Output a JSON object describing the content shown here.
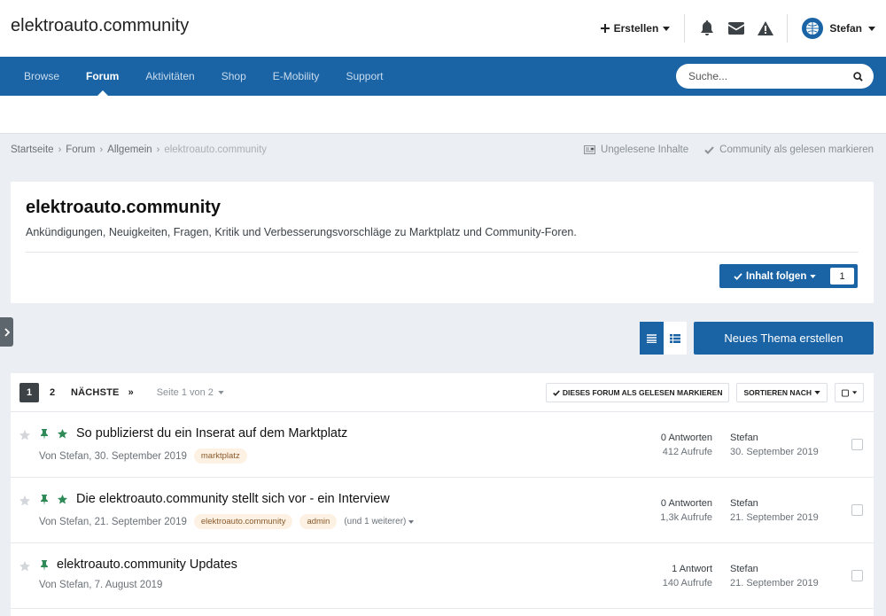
{
  "header": {
    "site_title": "elektroauto.community",
    "create_label": "Erstellen",
    "user_name": "Stefan"
  },
  "nav": {
    "items": [
      "Browse",
      "Forum",
      "Aktivitäten",
      "Shop",
      "E-Mobility",
      "Support"
    ],
    "active": "Forum",
    "search_placeholder": "Suche..."
  },
  "breadcrumb": {
    "items": [
      "Startseite",
      "Forum",
      "Allgemein",
      "elektroauto.community"
    ],
    "unread_label": "Ungelesene Inhalte",
    "mark_read_label": "Community als gelesen markieren"
  },
  "forum": {
    "title": "elektroauto.community",
    "description": "Ankündigungen, Neuigkeiten, Fragen, Kritik und Verbesserungsvorschläge zu Marktplatz und Community-Foren.",
    "follow_label": "Inhalt folgen",
    "follow_count": "1",
    "new_topic_label": "Neues Thema erstellen"
  },
  "toolbar": {
    "pages": [
      "1",
      "2"
    ],
    "next_label": "NÄCHSTE",
    "last_label": "»",
    "page_info": "Seite 1 von 2",
    "mark_forum_read_label": "DIESES FORUM ALS GELESEN MARKIEREN",
    "sort_label": "SORTIEREN NACH"
  },
  "topics": [
    {
      "title": "So publizierst du ein Inserat auf dem Marktplatz",
      "meta": "Von Stefan, 30. September 2019",
      "tags": [
        "marktplatz"
      ],
      "more_tags": "",
      "replies": "0 Antworten",
      "views": "412 Aufrufe",
      "last_user": "Stefan",
      "last_date": "30. September 2019",
      "featured": true
    },
    {
      "title": "Die elektroauto.community stellt sich vor - ein Interview",
      "meta": "Von Stefan, 21. September 2019",
      "tags": [
        "elektroauto.community",
        "admin"
      ],
      "more_tags": "(und 1 weiterer)",
      "replies": "0 Antworten",
      "views": "1,3k Aufrufe",
      "last_user": "Stefan",
      "last_date": "21. September 2019",
      "featured": true
    },
    {
      "title": "elektroauto.community Updates",
      "meta": "Von Stefan, 7. August 2019",
      "tags": [],
      "more_tags": "",
      "replies": "1 Antwort",
      "views": "140 Aufrufe",
      "last_user": "Stefan",
      "last_date": "21. September 2019",
      "featured": false
    }
  ],
  "colors": {
    "brand": "#1a64a6",
    "pin": "#2e8b57",
    "tag_bg": "#fdf1e3"
  }
}
